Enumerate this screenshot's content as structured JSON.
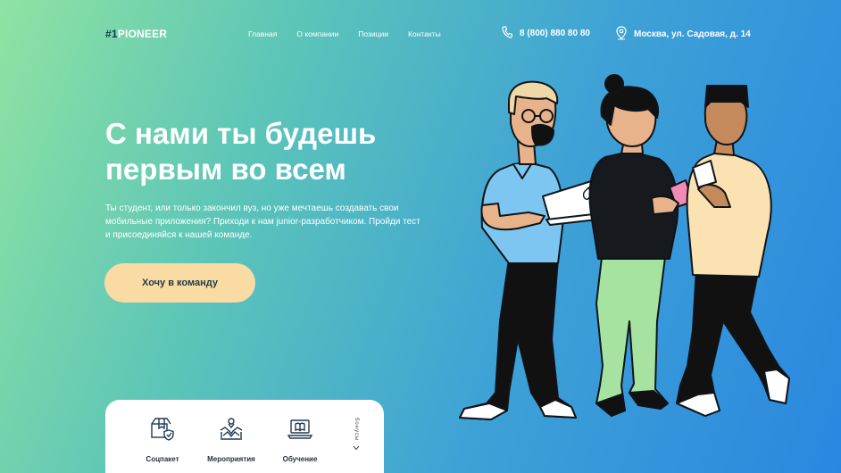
{
  "header": {
    "logo_hash": "#1",
    "logo_name": "PIONEER",
    "nav": [
      "Главная",
      "О компании",
      "Позиции",
      "Контакты"
    ],
    "phone": "8 (800) 880 80 80",
    "address": "Москва, ул. Садовая, д. 14"
  },
  "hero": {
    "title": "С нами ты будешь первым во всем",
    "text": "Ты студент, или только закончил вуз, но уже мечтаешь создавать свои мобильные приложения? Приходи к нам junior-разработчиком. Пройди тест и присоединяйся к нашей команде.",
    "cta": "Хочу в команду"
  },
  "benefits": {
    "items": [
      {
        "label": "Соцпакет",
        "icon": "box-shield-icon"
      },
      {
        "label": "Мероприятия",
        "icon": "handshake-icon"
      },
      {
        "label": "Обучение",
        "icon": "laptop-book-icon"
      }
    ],
    "bonus_label": "бонусы"
  },
  "colors": {
    "gradient_start": "#8fe3a2",
    "gradient_end": "#2a87e0",
    "cta_bg": "#f9dba3",
    "dark_text": "#1f3a44"
  }
}
